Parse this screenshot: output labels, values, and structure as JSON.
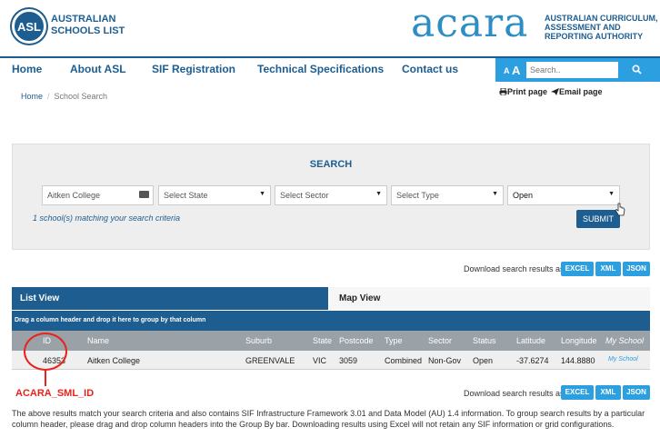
{
  "header": {
    "asl_logo_text": "ASL",
    "asl_line1": "AUSTRALIAN",
    "asl_line2": "SCHOOLS LIST",
    "acara_word": "acara",
    "acara_line1": "AUSTRALIAN CURRICULUM,",
    "acara_line2": "ASSESSMENT AND",
    "acara_line3": "REPORTING AUTHORITY"
  },
  "nav": {
    "items": [
      "Home",
      "About ASL",
      "SIF Registration",
      "Technical Specifications",
      "Contact us"
    ],
    "font_small": "A",
    "font_large": "A",
    "search_placeholder": "Search..",
    "search_icon": "search-icon"
  },
  "breadcrumb": {
    "home": "Home",
    "separator": "/",
    "current": "School Search"
  },
  "actions": {
    "print": "Print page",
    "email": "Email page"
  },
  "search": {
    "title": "SEARCH",
    "school_name_value": "Aitken College",
    "state_placeholder": "Select State",
    "sector_placeholder": "Select Sector",
    "type_placeholder": "Select Type",
    "status_value": "Open",
    "match_text": "1 school(s) matching your search criteria",
    "submit_label": "SUBMIT"
  },
  "download": {
    "label": "Download search results as:",
    "buttons": [
      "EXCEL",
      "XML",
      "JSON"
    ]
  },
  "tabs": {
    "list_view": "List View",
    "map_view": "Map View"
  },
  "group_bar": "Drag a column header and drop it here to group by that column",
  "grid": {
    "columns": [
      "ID",
      "Name",
      "Suburb",
      "State",
      "Postcode",
      "Type",
      "Sector",
      "Status",
      "Latitude",
      "Longitude",
      "My School"
    ],
    "rows": [
      {
        "id": "46353",
        "name": "Aitken College",
        "suburb": "GREENVALE",
        "state": "VIC",
        "postcode": "3059",
        "type": "Combined",
        "sector": "Non-Gov",
        "status": "Open",
        "latitude": "-37.6274",
        "longitude": "144.8880",
        "myschool": "My School"
      }
    ]
  },
  "annotation": {
    "label": "ACARA_SML_ID",
    "color": "#e8231b"
  },
  "notes": "The above results match your search criteria and also contains SIF Infrastructure Framework 3.01 and Data Model (AU) 1.4 information. To group search results by a particular column header, please drag and drop column headers into the Group By bar. Downloading results using Excel will not retain any SIF information or grid configurations.",
  "colors": {
    "brand_dark": "#1d5d8f",
    "brand_light": "#2b9fe0",
    "grid_header": "#9aa1a7"
  }
}
